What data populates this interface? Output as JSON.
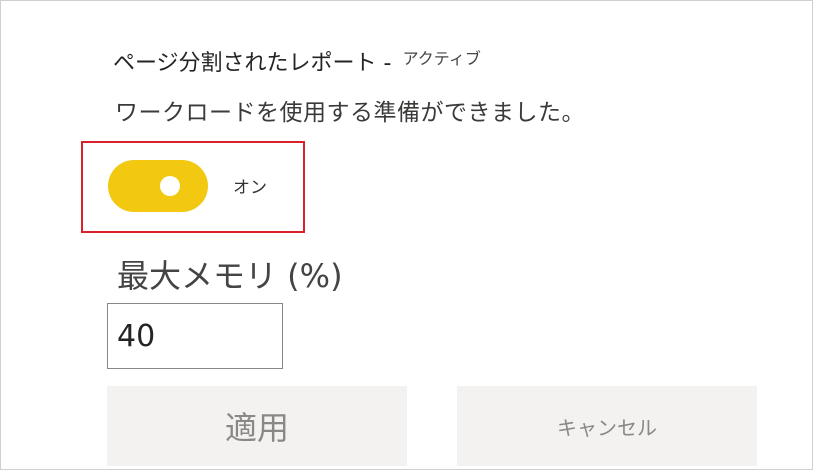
{
  "workload": {
    "title": "ページ分割されたレポート -",
    "status": "アクティブ",
    "description": "ワークロードを使用する準備ができました。"
  },
  "toggle": {
    "label": "オン",
    "state": "on",
    "color": "#f2c811"
  },
  "highlight": {
    "color": "#d9202c"
  },
  "memory": {
    "label": "最大メモリ (%)",
    "value": "40"
  },
  "buttons": {
    "apply": "適用",
    "cancel": "キャンセル"
  }
}
